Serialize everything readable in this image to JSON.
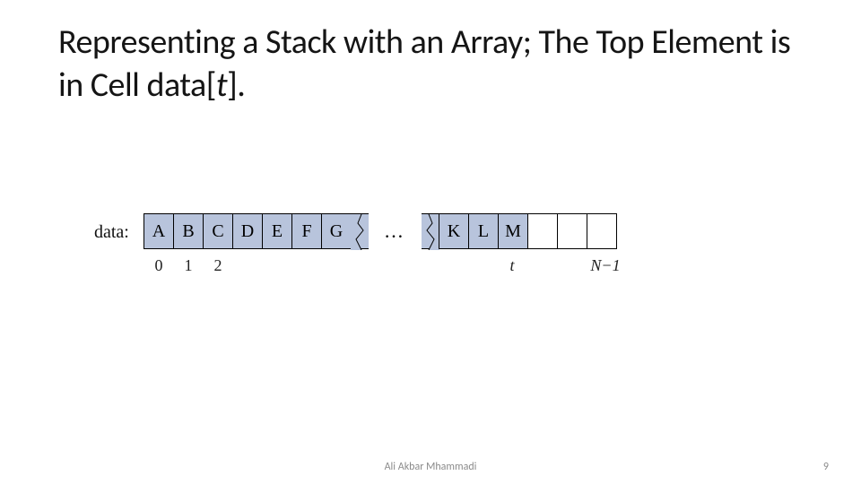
{
  "title": {
    "prefix": "Representing a Stack with an Array; The Top Element is in Cell data[",
    "var": "t",
    "suffix": "]."
  },
  "diagram": {
    "label": "data:",
    "left_cells": [
      "A",
      "B",
      "C",
      "D",
      "E",
      "F",
      "G"
    ],
    "ellipsis": "…",
    "right_cells": [
      "K",
      "L",
      "M"
    ],
    "empty_count": 3,
    "indices_left": [
      "0",
      "1",
      "2"
    ],
    "index_t": "t",
    "index_last": "N−1"
  },
  "footer": {
    "author": "Ali Akbar Mhammadi",
    "page": "9"
  }
}
